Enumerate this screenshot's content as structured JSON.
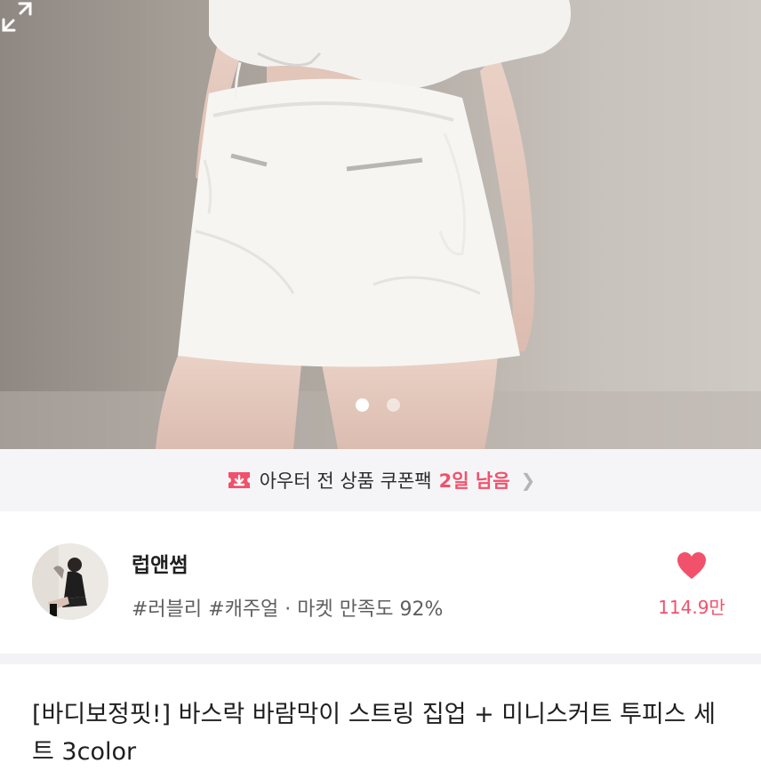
{
  "hero": {
    "image": "product-photo-white-skirt-set",
    "carousel": {
      "count": 2,
      "active_index": 0
    }
  },
  "coupon": {
    "icon": "coupon-ticket-icon",
    "text": "아우터 전 상품 쿠폰팩",
    "highlight": "2일 남음",
    "accent_color": "#f2516b"
  },
  "seller": {
    "name": "럽앤썸",
    "tags": "#러블리 #캐주얼 · 마켓 만족도 92%",
    "likes": "114.9만"
  },
  "product": {
    "title": "[바디보정핏!] 바스락 바람막이 스트링 집업 + 미니스커트 투피스 세트 3color"
  }
}
